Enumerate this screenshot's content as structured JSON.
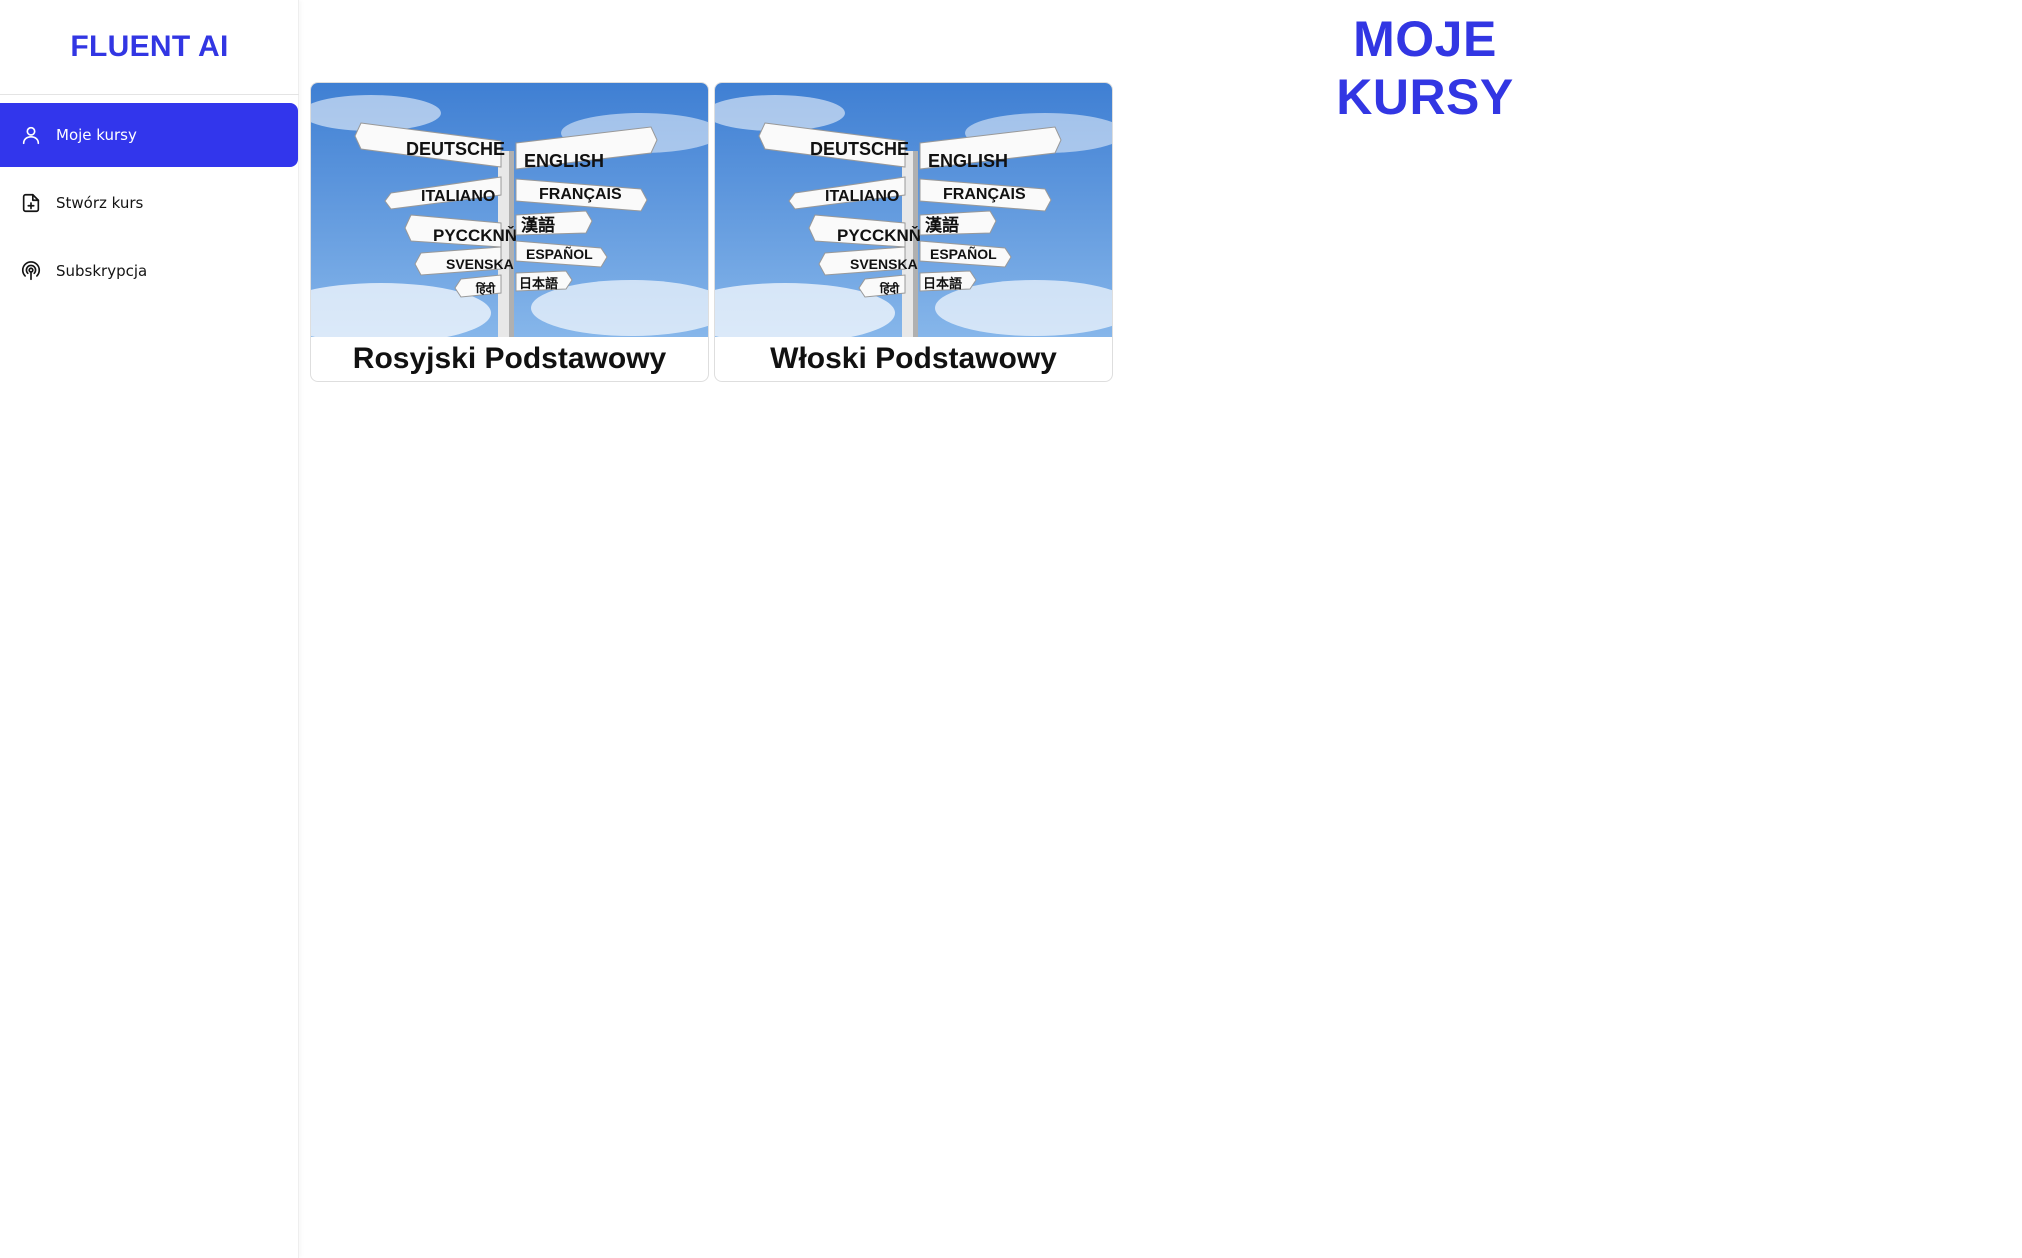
{
  "app": {
    "title": "FLUENT AI"
  },
  "sidebar": {
    "items": [
      {
        "label": "Moje kursy",
        "icon": "user-icon",
        "active": true
      },
      {
        "label": "Stwórz kurs",
        "icon": "file-plus-icon",
        "active": false
      },
      {
        "label": "Subskrypcja",
        "icon": "podcast-icon",
        "active": false
      }
    ]
  },
  "main": {
    "title": "MOJE KURSY",
    "courses": [
      {
        "name": "Rosyjski Podstawowy"
      },
      {
        "name": "Włoski Podstawowy"
      }
    ],
    "signpost": {
      "left_signs": [
        "DEUTSCHE",
        "ITALIANO",
        "PYCCKNŇ",
        "SVENSKA",
        "हिंदी"
      ],
      "right_signs": [
        "ENGLISH",
        "FRANÇAIS",
        "漢語",
        "ESPAÑOL",
        "日本語"
      ]
    }
  },
  "colors": {
    "accent": "#3236e3",
    "active_bg": "#3236ec",
    "sky": "#4f8fd9"
  }
}
